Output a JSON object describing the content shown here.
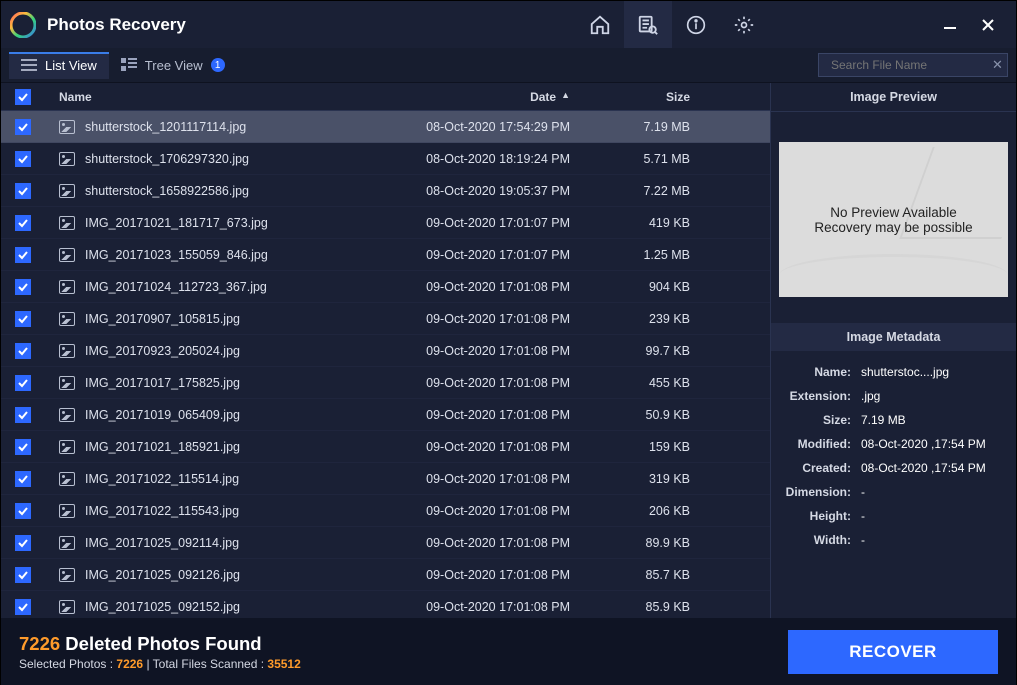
{
  "app": {
    "title": "Photos Recovery"
  },
  "tabs": {
    "list_view": "List View",
    "tree_view": "Tree View",
    "tree_badge": "1"
  },
  "search": {
    "placeholder": "Search File Name"
  },
  "columns": {
    "name": "Name",
    "date": "Date",
    "size": "Size"
  },
  "files": [
    {
      "name": "shutterstock_1201117114.jpg",
      "date": "08-Oct-2020 17:54:29 PM",
      "size": "7.19 MB",
      "selected": true
    },
    {
      "name": "shutterstock_1706297320.jpg",
      "date": "08-Oct-2020 18:19:24 PM",
      "size": "5.71 MB",
      "selected": false
    },
    {
      "name": "shutterstock_1658922586.jpg",
      "date": "08-Oct-2020 19:05:37 PM",
      "size": "7.22 MB",
      "selected": false
    },
    {
      "name": "IMG_20171021_181717_673.jpg",
      "date": "09-Oct-2020 17:01:07 PM",
      "size": "419 KB",
      "selected": false
    },
    {
      "name": "IMG_20171023_155059_846.jpg",
      "date": "09-Oct-2020 17:01:07 PM",
      "size": "1.25 MB",
      "selected": false
    },
    {
      "name": "IMG_20171024_112723_367.jpg",
      "date": "09-Oct-2020 17:01:08 PM",
      "size": "904 KB",
      "selected": false
    },
    {
      "name": "IMG_20170907_105815.jpg",
      "date": "09-Oct-2020 17:01:08 PM",
      "size": "239 KB",
      "selected": false
    },
    {
      "name": "IMG_20170923_205024.jpg",
      "date": "09-Oct-2020 17:01:08 PM",
      "size": "99.7 KB",
      "selected": false
    },
    {
      "name": "IMG_20171017_175825.jpg",
      "date": "09-Oct-2020 17:01:08 PM",
      "size": "455 KB",
      "selected": false
    },
    {
      "name": "IMG_20171019_065409.jpg",
      "date": "09-Oct-2020 17:01:08 PM",
      "size": "50.9 KB",
      "selected": false
    },
    {
      "name": "IMG_20171021_185921.jpg",
      "date": "09-Oct-2020 17:01:08 PM",
      "size": "159 KB",
      "selected": false
    },
    {
      "name": "IMG_20171022_115514.jpg",
      "date": "09-Oct-2020 17:01:08 PM",
      "size": "319 KB",
      "selected": false
    },
    {
      "name": "IMG_20171022_115543.jpg",
      "date": "09-Oct-2020 17:01:08 PM",
      "size": "206 KB",
      "selected": false
    },
    {
      "name": "IMG_20171025_092114.jpg",
      "date": "09-Oct-2020 17:01:08 PM",
      "size": "89.9 KB",
      "selected": false
    },
    {
      "name": "IMG_20171025_092126.jpg",
      "date": "09-Oct-2020 17:01:08 PM",
      "size": "85.7 KB",
      "selected": false
    },
    {
      "name": "IMG_20171025_092152.jpg",
      "date": "09-Oct-2020 17:01:08 PM",
      "size": "85.9 KB",
      "selected": false
    }
  ],
  "preview": {
    "header": "Image Preview",
    "line1": "No Preview Available",
    "line2": "Recovery may be possible"
  },
  "metadata": {
    "header": "Image Metadata",
    "name_key": "Name:",
    "name_val": "shutterstoc....jpg",
    "ext_key": "Extension:",
    "ext_val": ".jpg",
    "size_key": "Size:",
    "size_val": "7.19 MB",
    "mod_key": "Modified:",
    "mod_val": "08-Oct-2020 ,17:54 PM",
    "cre_key": "Created:",
    "cre_val": "08-Oct-2020 ,17:54 PM",
    "dim_key": "Dimension:",
    "dim_val": "-",
    "h_key": "Height:",
    "h_val": "-",
    "w_key": "Width:",
    "w_val": "-"
  },
  "summary": {
    "count": "7226",
    "count_suffix": " Deleted Photos Found",
    "sub_pre": "Selected Photos : ",
    "sub_sel": "7226",
    "sub_mid": " | Total Files Scanned : ",
    "sub_tot": "35512"
  },
  "recover_label": "RECOVER"
}
